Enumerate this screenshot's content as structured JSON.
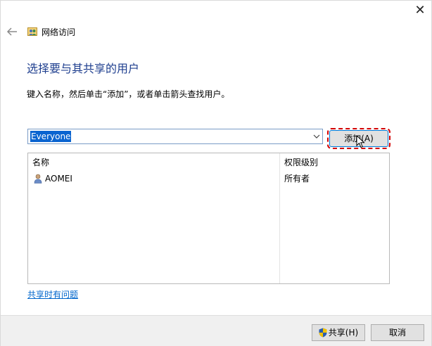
{
  "window": {
    "title": "网络访问",
    "close_glyph": "✕"
  },
  "page": {
    "heading": "选择要与其共享的用户",
    "instruction": "键入名称，然后单击“添加”，或者单击箭头查找用户。"
  },
  "picker": {
    "value": "Everyone",
    "add_label": "添加(A)"
  },
  "table": {
    "headers": {
      "name": "名称",
      "permission": "权限级别"
    },
    "rows": [
      {
        "name": "AOMEI",
        "permission": "所有者"
      }
    ]
  },
  "help": {
    "link": "共享时有问题"
  },
  "footer": {
    "share_label": "共享(H)",
    "cancel_label": "取消"
  },
  "icons": {
    "back": "back-arrow-icon",
    "title": "network-users-icon",
    "dropdown": "chevron-down-icon",
    "user": "user-icon",
    "shield": "uac-shield-icon",
    "cursor": "mouse-pointer-icon"
  },
  "colors": {
    "heading": "#1f3f8f",
    "link": "#0066cc",
    "selection": "#0a64d0",
    "highlight": "#d40000"
  }
}
